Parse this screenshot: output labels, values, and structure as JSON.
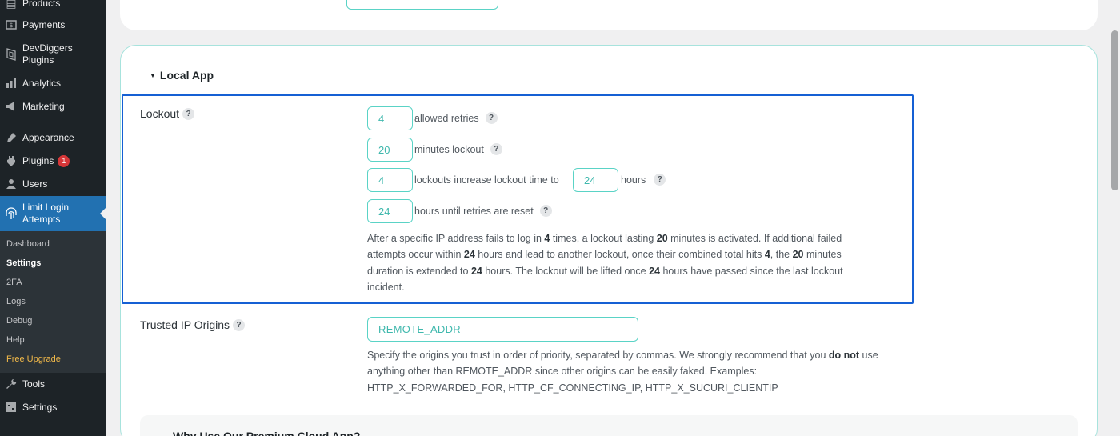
{
  "sidebar": {
    "items": [
      {
        "label": "Products",
        "icon": "products-icon"
      },
      {
        "label": "Payments",
        "icon": "payments-icon"
      },
      {
        "label": "DevDiggers Plugins",
        "icon": "devdiggers-icon"
      },
      {
        "label": "Analytics",
        "icon": "analytics-icon"
      },
      {
        "label": "Marketing",
        "icon": "marketing-icon"
      },
      {
        "label": "Appearance",
        "icon": "appearance-icon"
      },
      {
        "label": "Plugins",
        "icon": "plugins-icon",
        "badge": "1"
      },
      {
        "label": "Users",
        "icon": "users-icon"
      },
      {
        "label": "Limit Login Attempts",
        "icon": "fingerprint-icon"
      },
      {
        "label": "Tools",
        "icon": "tools-icon"
      },
      {
        "label": "Settings",
        "icon": "settings-icon"
      }
    ],
    "submenu": [
      "Dashboard",
      "Settings",
      "2FA",
      "Logs",
      "Debug",
      "Help",
      "Free Upgrade"
    ],
    "colors": {
      "background": "#1d2327",
      "active": "#2271b1",
      "upgrade": "#f0b849"
    }
  },
  "main": {
    "section_title": "Local App",
    "lockout": {
      "label": "Lockout",
      "help": "?",
      "allowed_retries": {
        "value": "4",
        "text": "allowed retries"
      },
      "minutes_lockout": {
        "value": "20",
        "text": "minutes lockout"
      },
      "lockouts_increase": {
        "value": "4",
        "text": "lockouts increase lockout time to",
        "hours_value": "24",
        "hours_text": "hours"
      },
      "hours_until_reset": {
        "value": "24",
        "text": "hours until retries are reset"
      },
      "description": {
        "p1": "After a specific IP address fails to log in ",
        "b1": "4",
        "p2": " times, a lockout lasting ",
        "b2": "20",
        "p3": " minutes is activated. If additional failed attempts occur within ",
        "b3": "24",
        "p4": " hours and lead to another lockout, once their combined total hits ",
        "b4": "4",
        "p5": ", the ",
        "b5": "20",
        "p6": " minutes duration is extended to ",
        "b6": "24",
        "p7": " hours. The lockout will be lifted once ",
        "b7": "24",
        "p8": " hours have passed since the last lockout incident."
      }
    },
    "trusted_ip": {
      "label": "Trusted IP Origins",
      "help": "?",
      "value": "REMOTE_ADDR",
      "desc_p1": "Specify the origins you trust in order of priority, separated by commas. We strongly recommend that you ",
      "desc_b1": "do not",
      "desc_p2": " use anything other than REMOTE_ADDR since other origins can be easily faked. Examples: HTTP_X_FORWARDED_FOR, HTTP_CF_CONNECTING_IP, HTTP_X_SUCURI_CLIENTIP"
    },
    "promo_title": "Why Use Our Premium Cloud App?",
    "colors": {
      "accent": "#5ad3c6",
      "highlight": "#1560d4"
    }
  }
}
